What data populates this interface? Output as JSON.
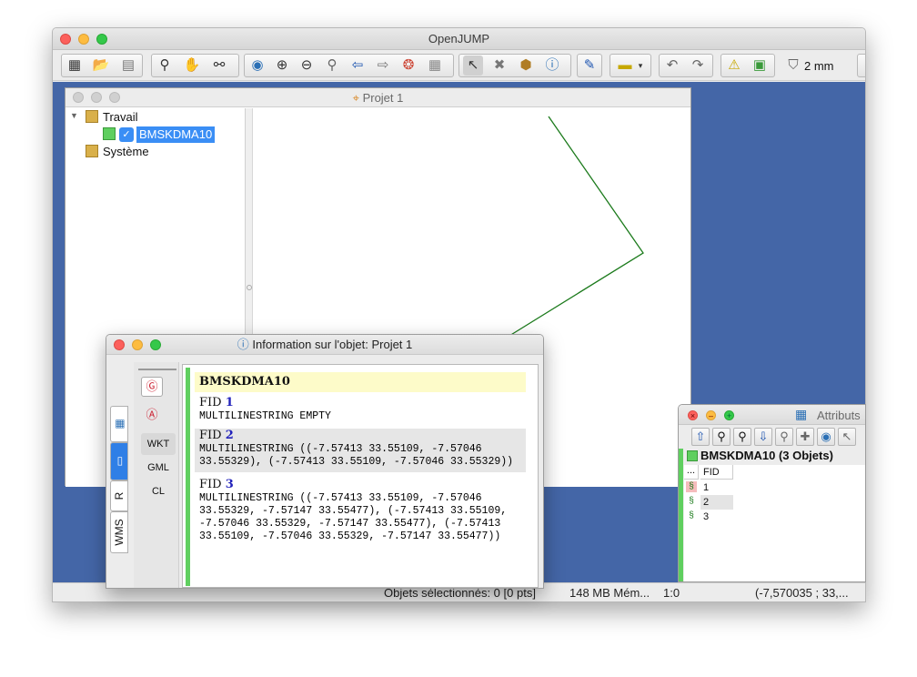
{
  "app": {
    "title": "OpenJUMP",
    "scale_label": "2 mm"
  },
  "project": {
    "title": "Projet 1",
    "tree": {
      "travail": "Travail",
      "layer": "BMSKDMA10",
      "systeme": "Système"
    }
  },
  "info": {
    "title": "Information sur l'objet: Projet 1",
    "layer_name": "BMSKDMA10",
    "tabs": [
      "R",
      "WMS"
    ],
    "formats": [
      "WKT",
      "GML",
      "CL"
    ],
    "features": [
      {
        "fid_label": "FID",
        "fid": "1",
        "wkt": "MULTILINESTRING EMPTY"
      },
      {
        "fid_label": "FID",
        "fid": "2",
        "wkt": "MULTILINESTRING ((-7.57413 33.55109, -7.57046\n33.55329), (-7.57413 33.55109, -7.57046 33.55329))"
      },
      {
        "fid_label": "FID",
        "fid": "3",
        "wkt": "MULTILINESTRING ((-7.57413 33.55109, -7.57046\n33.55329, -7.57147 33.55477), (-7.57413 33.55109,\n-7.57046 33.55329, -7.57147 33.55477), (-7.57413\n33.55109, -7.57046 33.55329, -7.57147 33.55477))"
      }
    ]
  },
  "attributes": {
    "title": "Attributs",
    "layer_header": "BMSKDMA10 (3 Objets)",
    "col_corner": "...",
    "column": "FID",
    "rows": [
      "1",
      "2",
      "3"
    ]
  },
  "status": {
    "selection": "Objets sélectionnés: 0 [0 pts]",
    "memory": "148 MB Mém...",
    "scale": "1:0",
    "coords": "(-7,570035 ; 33,..."
  },
  "colors": {
    "desktop": "#4466a7",
    "geometry": "#1b7a1b",
    "layer_green": "#5fcf5f",
    "fid_blue": "#2222bb"
  }
}
